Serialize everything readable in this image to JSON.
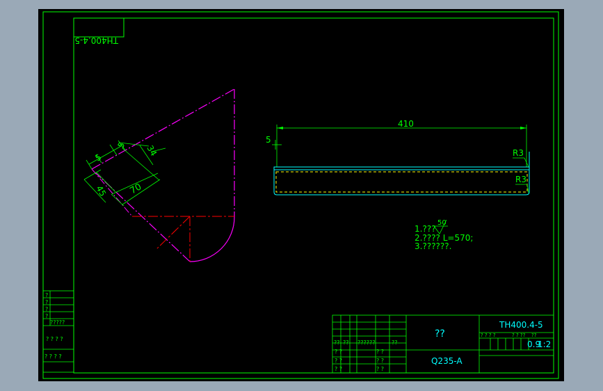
{
  "colors": {
    "window_bg": "#9aa9b7",
    "canvas_bg": "#000000",
    "frame": "#00ff00",
    "part_outline": "#ff00ff",
    "dimension": "#00ff00",
    "center_line": "#ff0000",
    "side_view": "#00ffff",
    "hidden_line": "#ffff00",
    "title_text": "#00ffff"
  },
  "drawing_number_mirrored": "TH400.4-5",
  "side_view": {
    "dim_length": "410",
    "dim_thickness": "5",
    "radius_top": "R3",
    "radius_bottom": "R3"
  },
  "flat_pattern": {
    "dims": [
      "5",
      "5",
      "34",
      "45",
      "70"
    ]
  },
  "notes": {
    "roughness": "50",
    "lines": [
      "1.???",
      "2.????  L=570;",
      "3.??????."
    ]
  },
  "left_strip": {
    "rows": [
      "?",
      "?",
      "?",
      "?",
      "?????",
      "? ? ? ?",
      "? ? ?   ?"
    ]
  },
  "title_block": {
    "part_name": "??",
    "drawing_no": "TH400.4-5",
    "material": "Q235-A",
    "weight": "0.9",
    "scale": "1:2",
    "cell_marks": [
      "??",
      "??",
      "??????",
      "??",
      "? ?",
      "? ?",
      "? ?",
      "? ?",
      "? ?",
      "? ?",
      "? ? ? ?",
      "? ? ??",
      "??"
    ]
  }
}
